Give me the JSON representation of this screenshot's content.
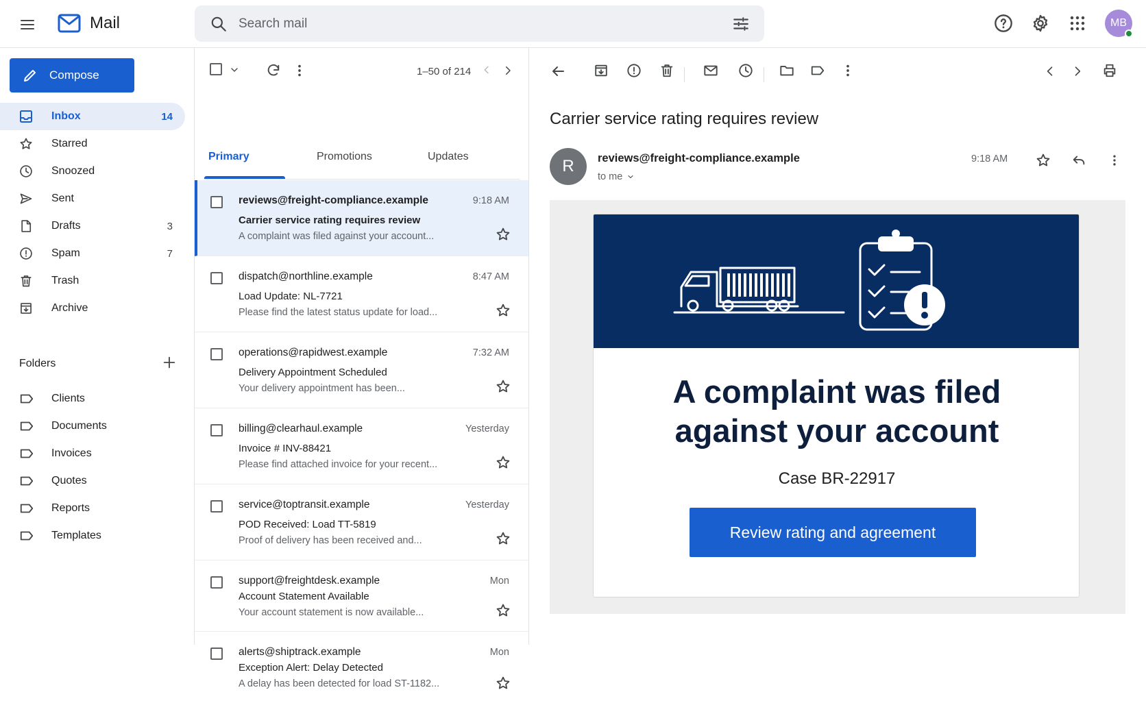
{
  "header": {
    "app_title": "Mail",
    "search_placeholder": "Search mail",
    "avatar_initials": "MB",
    "icons": [
      "menu-icon",
      "mail-logo-icon",
      "search-icon",
      "tune-icon",
      "help-icon",
      "settings-icon",
      "apps-icon"
    ]
  },
  "sidebar": {
    "compose_label": "Compose",
    "items": [
      {
        "label": "Inbox",
        "count": "14",
        "icon": "inbox-icon",
        "active": true
      },
      {
        "label": "Starred",
        "count": "",
        "icon": "star-icon"
      },
      {
        "label": "Snoozed",
        "count": "",
        "icon": "clock-icon"
      },
      {
        "label": "Sent",
        "count": "",
        "icon": "send-icon"
      },
      {
        "label": "Drafts",
        "count": "3",
        "icon": "draft-icon"
      },
      {
        "label": "Spam",
        "count": "7",
        "icon": "spam-icon"
      },
      {
        "label": "Trash",
        "count": "",
        "icon": "trash-icon"
      },
      {
        "label": "Archive",
        "count": "",
        "icon": "archive-icon"
      }
    ],
    "folders_title": "Folders",
    "folders": [
      "Clients",
      "Documents",
      "Invoices",
      "Quotes",
      "Reports",
      "Templates"
    ]
  },
  "list": {
    "pager": "1–50 of 214",
    "tabs": [
      "Primary",
      "Promotions",
      "Updates"
    ],
    "emails": [
      {
        "from": "reviews@freight-compliance.example",
        "time": "9:18 AM",
        "subject": "Carrier service rating requires review",
        "snippet": "A complaint was filed against your account...",
        "selected": true
      },
      {
        "from": "dispatch@northline.example",
        "time": "8:47 AM",
        "subject": "Load Update: NL-7721",
        "snippet": "Please find the latest status update for load..."
      },
      {
        "from": "operations@rapidwest.example",
        "time": "7:32 AM",
        "subject": "Delivery Appointment Scheduled",
        "snippet": "Your delivery appointment has been..."
      },
      {
        "from": "billing@clearhaul.example",
        "time": "Yesterday",
        "subject": "Invoice # INV-88421",
        "snippet": "Please find attached invoice for your recent..."
      },
      {
        "from": "service@toptransit.example",
        "time": "Yesterday",
        "subject": "POD Received: Load TT-5819",
        "snippet": "Proof of delivery has been received and..."
      },
      {
        "from": "support@freightdesk.example",
        "time": "Mon",
        "subject": "Account Statement Available",
        "snippet": "Your account statement is now available..."
      },
      {
        "from": "alerts@shiptrack.example",
        "time": "Mon",
        "subject": "Exception Alert: Delay Detected",
        "snippet": "A delay has been detected for load ST-1182..."
      }
    ]
  },
  "reading": {
    "subject": "Carrier service rating requires review",
    "sender_initial": "R",
    "sender_email": "reviews@freight-compliance.example",
    "to": "to me",
    "time": "9:18 AM",
    "card": {
      "headline_line1": "A complaint was filed",
      "headline_line2": "against your account",
      "case": "Case BR-22917",
      "cta": "Review rating and agreement"
    }
  }
}
